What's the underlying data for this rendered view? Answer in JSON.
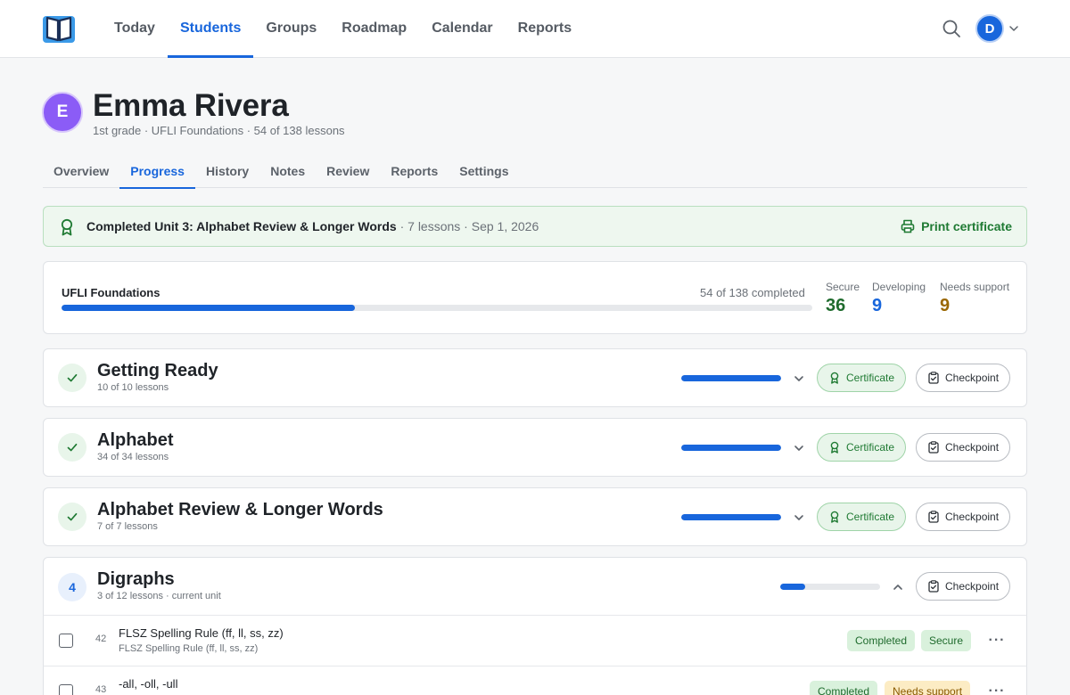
{
  "app": {
    "logo_icon": "open-book-icon",
    "nav": [
      {
        "label": "Today"
      },
      {
        "label": "Students",
        "active": true
      },
      {
        "label": "Groups"
      },
      {
        "label": "Roadmap"
      },
      {
        "label": "Calendar"
      },
      {
        "label": "Reports"
      }
    ],
    "user_initial": "D"
  },
  "student": {
    "initial": "E",
    "name": "Emma Rivera",
    "subtitle": "1st grade · UFLI Foundations · 54 of 138 lessons"
  },
  "tabs": [
    {
      "label": "Overview"
    },
    {
      "label": "Progress",
      "active": true
    },
    {
      "label": "History"
    },
    {
      "label": "Notes"
    },
    {
      "label": "Review"
    },
    {
      "label": "Reports"
    },
    {
      "label": "Settings"
    }
  ],
  "banner": {
    "title": "Completed Unit 3: Alphabet Review & Longer Words",
    "meta": " · 7 lessons · Sep 1, 2026",
    "action": "Print certificate"
  },
  "summary": {
    "title": "UFLI Foundations",
    "count_text": "54 of 138 completed",
    "completed": 54,
    "total": 138,
    "stats": [
      {
        "label": "Secure",
        "value": "36",
        "color": "#1f6b2d"
      },
      {
        "label": "Developing",
        "value": "9",
        "color": "#1866dc"
      },
      {
        "label": "Needs support",
        "value": "9",
        "color": "#9a6700"
      }
    ]
  },
  "units": [
    {
      "title": "Getting Ready",
      "subtitle": "10 of 10 lessons",
      "progress": 1.0,
      "certificate": "Certificate",
      "checkpoint": "Checkpoint",
      "expanded": false
    },
    {
      "title": "Alphabet",
      "subtitle": "34 of 34 lessons",
      "progress": 1.0,
      "certificate": "Certificate",
      "checkpoint": "Checkpoint",
      "expanded": false
    },
    {
      "title": "Alphabet Review & Longer Words",
      "subtitle": "7 of 7 lessons",
      "progress": 1.0,
      "certificate": "Certificate",
      "checkpoint": "Checkpoint",
      "expanded": false
    },
    {
      "number": "4",
      "title": "Digraphs",
      "subtitle": "3 of 12 lessons · current unit",
      "progress": 0.25,
      "checkpoint": "Checkpoint",
      "expanded": true
    }
  ],
  "lessons": [
    {
      "number": "42",
      "title": "FLSZ Spelling Rule (ff, ll, ss, zz)",
      "subtitle": "FLSZ Spelling Rule (ff, ll, ss, zz)",
      "status": "Completed",
      "mastery": "Secure"
    },
    {
      "number": "43",
      "title": "-all, -oll, -ull",
      "subtitle": "",
      "status": "Completed",
      "mastery": "Needs support"
    }
  ],
  "colors": {
    "accent": "#1866dc",
    "success": "#1f7a33",
    "warning": "#9a6700"
  }
}
